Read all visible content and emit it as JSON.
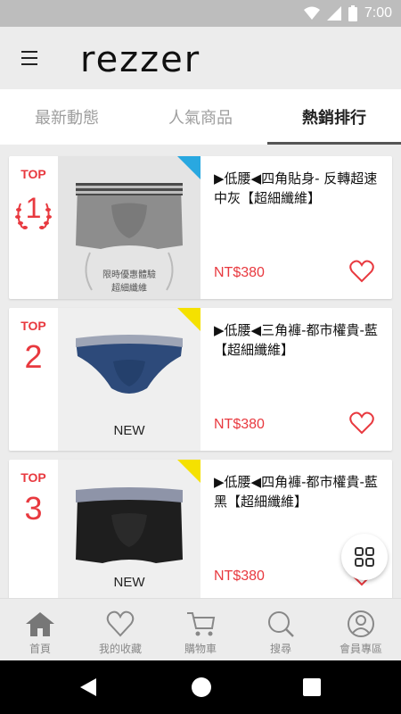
{
  "status_bar": {
    "time": "7:00"
  },
  "app": {
    "logo": "rezzer"
  },
  "tabs": [
    {
      "label": "最新動態",
      "active": false
    },
    {
      "label": "人氣商品",
      "active": false
    },
    {
      "label": "熱銷排行",
      "active": true
    }
  ],
  "products": [
    {
      "rank_label": "TOP",
      "rank": "1",
      "title": "▶低腰◀四角貼身- 反轉超速中灰【超細纖維】",
      "price": "NT$380",
      "corner_color": "#29a8e0",
      "image_badge": [
        "限時優惠體驗",
        "超細纖維"
      ],
      "image_label": ""
    },
    {
      "rank_label": "TOP",
      "rank": "2",
      "title": "▶低腰◀三角褲-都市權貴-藍【超細纖維】",
      "price": "NT$380",
      "corner_color": "#f5e100",
      "image_badge": [],
      "image_label": "NEW"
    },
    {
      "rank_label": "TOP",
      "rank": "3",
      "title": "▶低腰◀四角褲-都市權貴-藍黑【超細纖維】",
      "price": "NT$380",
      "corner_color": "#f5e100",
      "image_badge": [],
      "image_label": "NEW"
    }
  ],
  "bottom_nav": [
    {
      "label": "首頁",
      "icon": "home-icon"
    },
    {
      "label": "我的收藏",
      "icon": "heart-icon"
    },
    {
      "label": "購物車",
      "icon": "cart-icon"
    },
    {
      "label": "搜尋",
      "icon": "search-icon"
    },
    {
      "label": "會員專區",
      "icon": "user-icon"
    }
  ],
  "colors": {
    "accent": "#e8393f",
    "status_bar": "#bdbdbd"
  }
}
